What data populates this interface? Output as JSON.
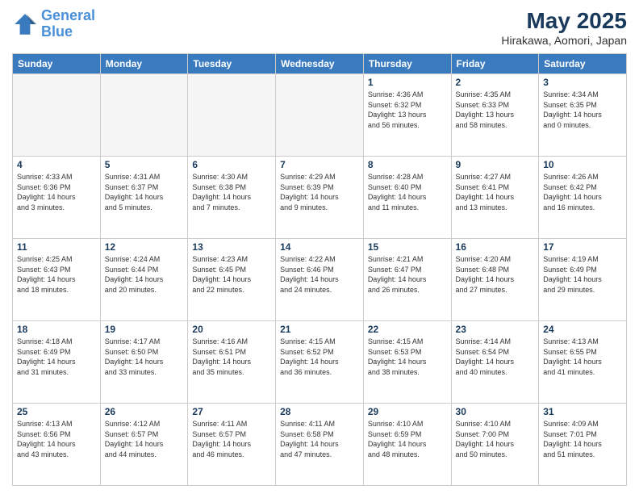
{
  "logo": {
    "line1": "General",
    "line2": "Blue"
  },
  "title": "May 2025",
  "subtitle": "Hirakawa, Aomori, Japan",
  "headers": [
    "Sunday",
    "Monday",
    "Tuesday",
    "Wednesday",
    "Thursday",
    "Friday",
    "Saturday"
  ],
  "weeks": [
    [
      {
        "day": "",
        "info": ""
      },
      {
        "day": "",
        "info": ""
      },
      {
        "day": "",
        "info": ""
      },
      {
        "day": "",
        "info": ""
      },
      {
        "day": "1",
        "info": "Sunrise: 4:36 AM\nSunset: 6:32 PM\nDaylight: 13 hours\nand 56 minutes."
      },
      {
        "day": "2",
        "info": "Sunrise: 4:35 AM\nSunset: 6:33 PM\nDaylight: 13 hours\nand 58 minutes."
      },
      {
        "day": "3",
        "info": "Sunrise: 4:34 AM\nSunset: 6:35 PM\nDaylight: 14 hours\nand 0 minutes."
      }
    ],
    [
      {
        "day": "4",
        "info": "Sunrise: 4:33 AM\nSunset: 6:36 PM\nDaylight: 14 hours\nand 3 minutes."
      },
      {
        "day": "5",
        "info": "Sunrise: 4:31 AM\nSunset: 6:37 PM\nDaylight: 14 hours\nand 5 minutes."
      },
      {
        "day": "6",
        "info": "Sunrise: 4:30 AM\nSunset: 6:38 PM\nDaylight: 14 hours\nand 7 minutes."
      },
      {
        "day": "7",
        "info": "Sunrise: 4:29 AM\nSunset: 6:39 PM\nDaylight: 14 hours\nand 9 minutes."
      },
      {
        "day": "8",
        "info": "Sunrise: 4:28 AM\nSunset: 6:40 PM\nDaylight: 14 hours\nand 11 minutes."
      },
      {
        "day": "9",
        "info": "Sunrise: 4:27 AM\nSunset: 6:41 PM\nDaylight: 14 hours\nand 13 minutes."
      },
      {
        "day": "10",
        "info": "Sunrise: 4:26 AM\nSunset: 6:42 PM\nDaylight: 14 hours\nand 16 minutes."
      }
    ],
    [
      {
        "day": "11",
        "info": "Sunrise: 4:25 AM\nSunset: 6:43 PM\nDaylight: 14 hours\nand 18 minutes."
      },
      {
        "day": "12",
        "info": "Sunrise: 4:24 AM\nSunset: 6:44 PM\nDaylight: 14 hours\nand 20 minutes."
      },
      {
        "day": "13",
        "info": "Sunrise: 4:23 AM\nSunset: 6:45 PM\nDaylight: 14 hours\nand 22 minutes."
      },
      {
        "day": "14",
        "info": "Sunrise: 4:22 AM\nSunset: 6:46 PM\nDaylight: 14 hours\nand 24 minutes."
      },
      {
        "day": "15",
        "info": "Sunrise: 4:21 AM\nSunset: 6:47 PM\nDaylight: 14 hours\nand 26 minutes."
      },
      {
        "day": "16",
        "info": "Sunrise: 4:20 AM\nSunset: 6:48 PM\nDaylight: 14 hours\nand 27 minutes."
      },
      {
        "day": "17",
        "info": "Sunrise: 4:19 AM\nSunset: 6:49 PM\nDaylight: 14 hours\nand 29 minutes."
      }
    ],
    [
      {
        "day": "18",
        "info": "Sunrise: 4:18 AM\nSunset: 6:49 PM\nDaylight: 14 hours\nand 31 minutes."
      },
      {
        "day": "19",
        "info": "Sunrise: 4:17 AM\nSunset: 6:50 PM\nDaylight: 14 hours\nand 33 minutes."
      },
      {
        "day": "20",
        "info": "Sunrise: 4:16 AM\nSunset: 6:51 PM\nDaylight: 14 hours\nand 35 minutes."
      },
      {
        "day": "21",
        "info": "Sunrise: 4:15 AM\nSunset: 6:52 PM\nDaylight: 14 hours\nand 36 minutes."
      },
      {
        "day": "22",
        "info": "Sunrise: 4:15 AM\nSunset: 6:53 PM\nDaylight: 14 hours\nand 38 minutes."
      },
      {
        "day": "23",
        "info": "Sunrise: 4:14 AM\nSunset: 6:54 PM\nDaylight: 14 hours\nand 40 minutes."
      },
      {
        "day": "24",
        "info": "Sunrise: 4:13 AM\nSunset: 6:55 PM\nDaylight: 14 hours\nand 41 minutes."
      }
    ],
    [
      {
        "day": "25",
        "info": "Sunrise: 4:13 AM\nSunset: 6:56 PM\nDaylight: 14 hours\nand 43 minutes."
      },
      {
        "day": "26",
        "info": "Sunrise: 4:12 AM\nSunset: 6:57 PM\nDaylight: 14 hours\nand 44 minutes."
      },
      {
        "day": "27",
        "info": "Sunrise: 4:11 AM\nSunset: 6:57 PM\nDaylight: 14 hours\nand 46 minutes."
      },
      {
        "day": "28",
        "info": "Sunrise: 4:11 AM\nSunset: 6:58 PM\nDaylight: 14 hours\nand 47 minutes."
      },
      {
        "day": "29",
        "info": "Sunrise: 4:10 AM\nSunset: 6:59 PM\nDaylight: 14 hours\nand 48 minutes."
      },
      {
        "day": "30",
        "info": "Sunrise: 4:10 AM\nSunset: 7:00 PM\nDaylight: 14 hours\nand 50 minutes."
      },
      {
        "day": "31",
        "info": "Sunrise: 4:09 AM\nSunset: 7:01 PM\nDaylight: 14 hours\nand 51 minutes."
      }
    ]
  ]
}
